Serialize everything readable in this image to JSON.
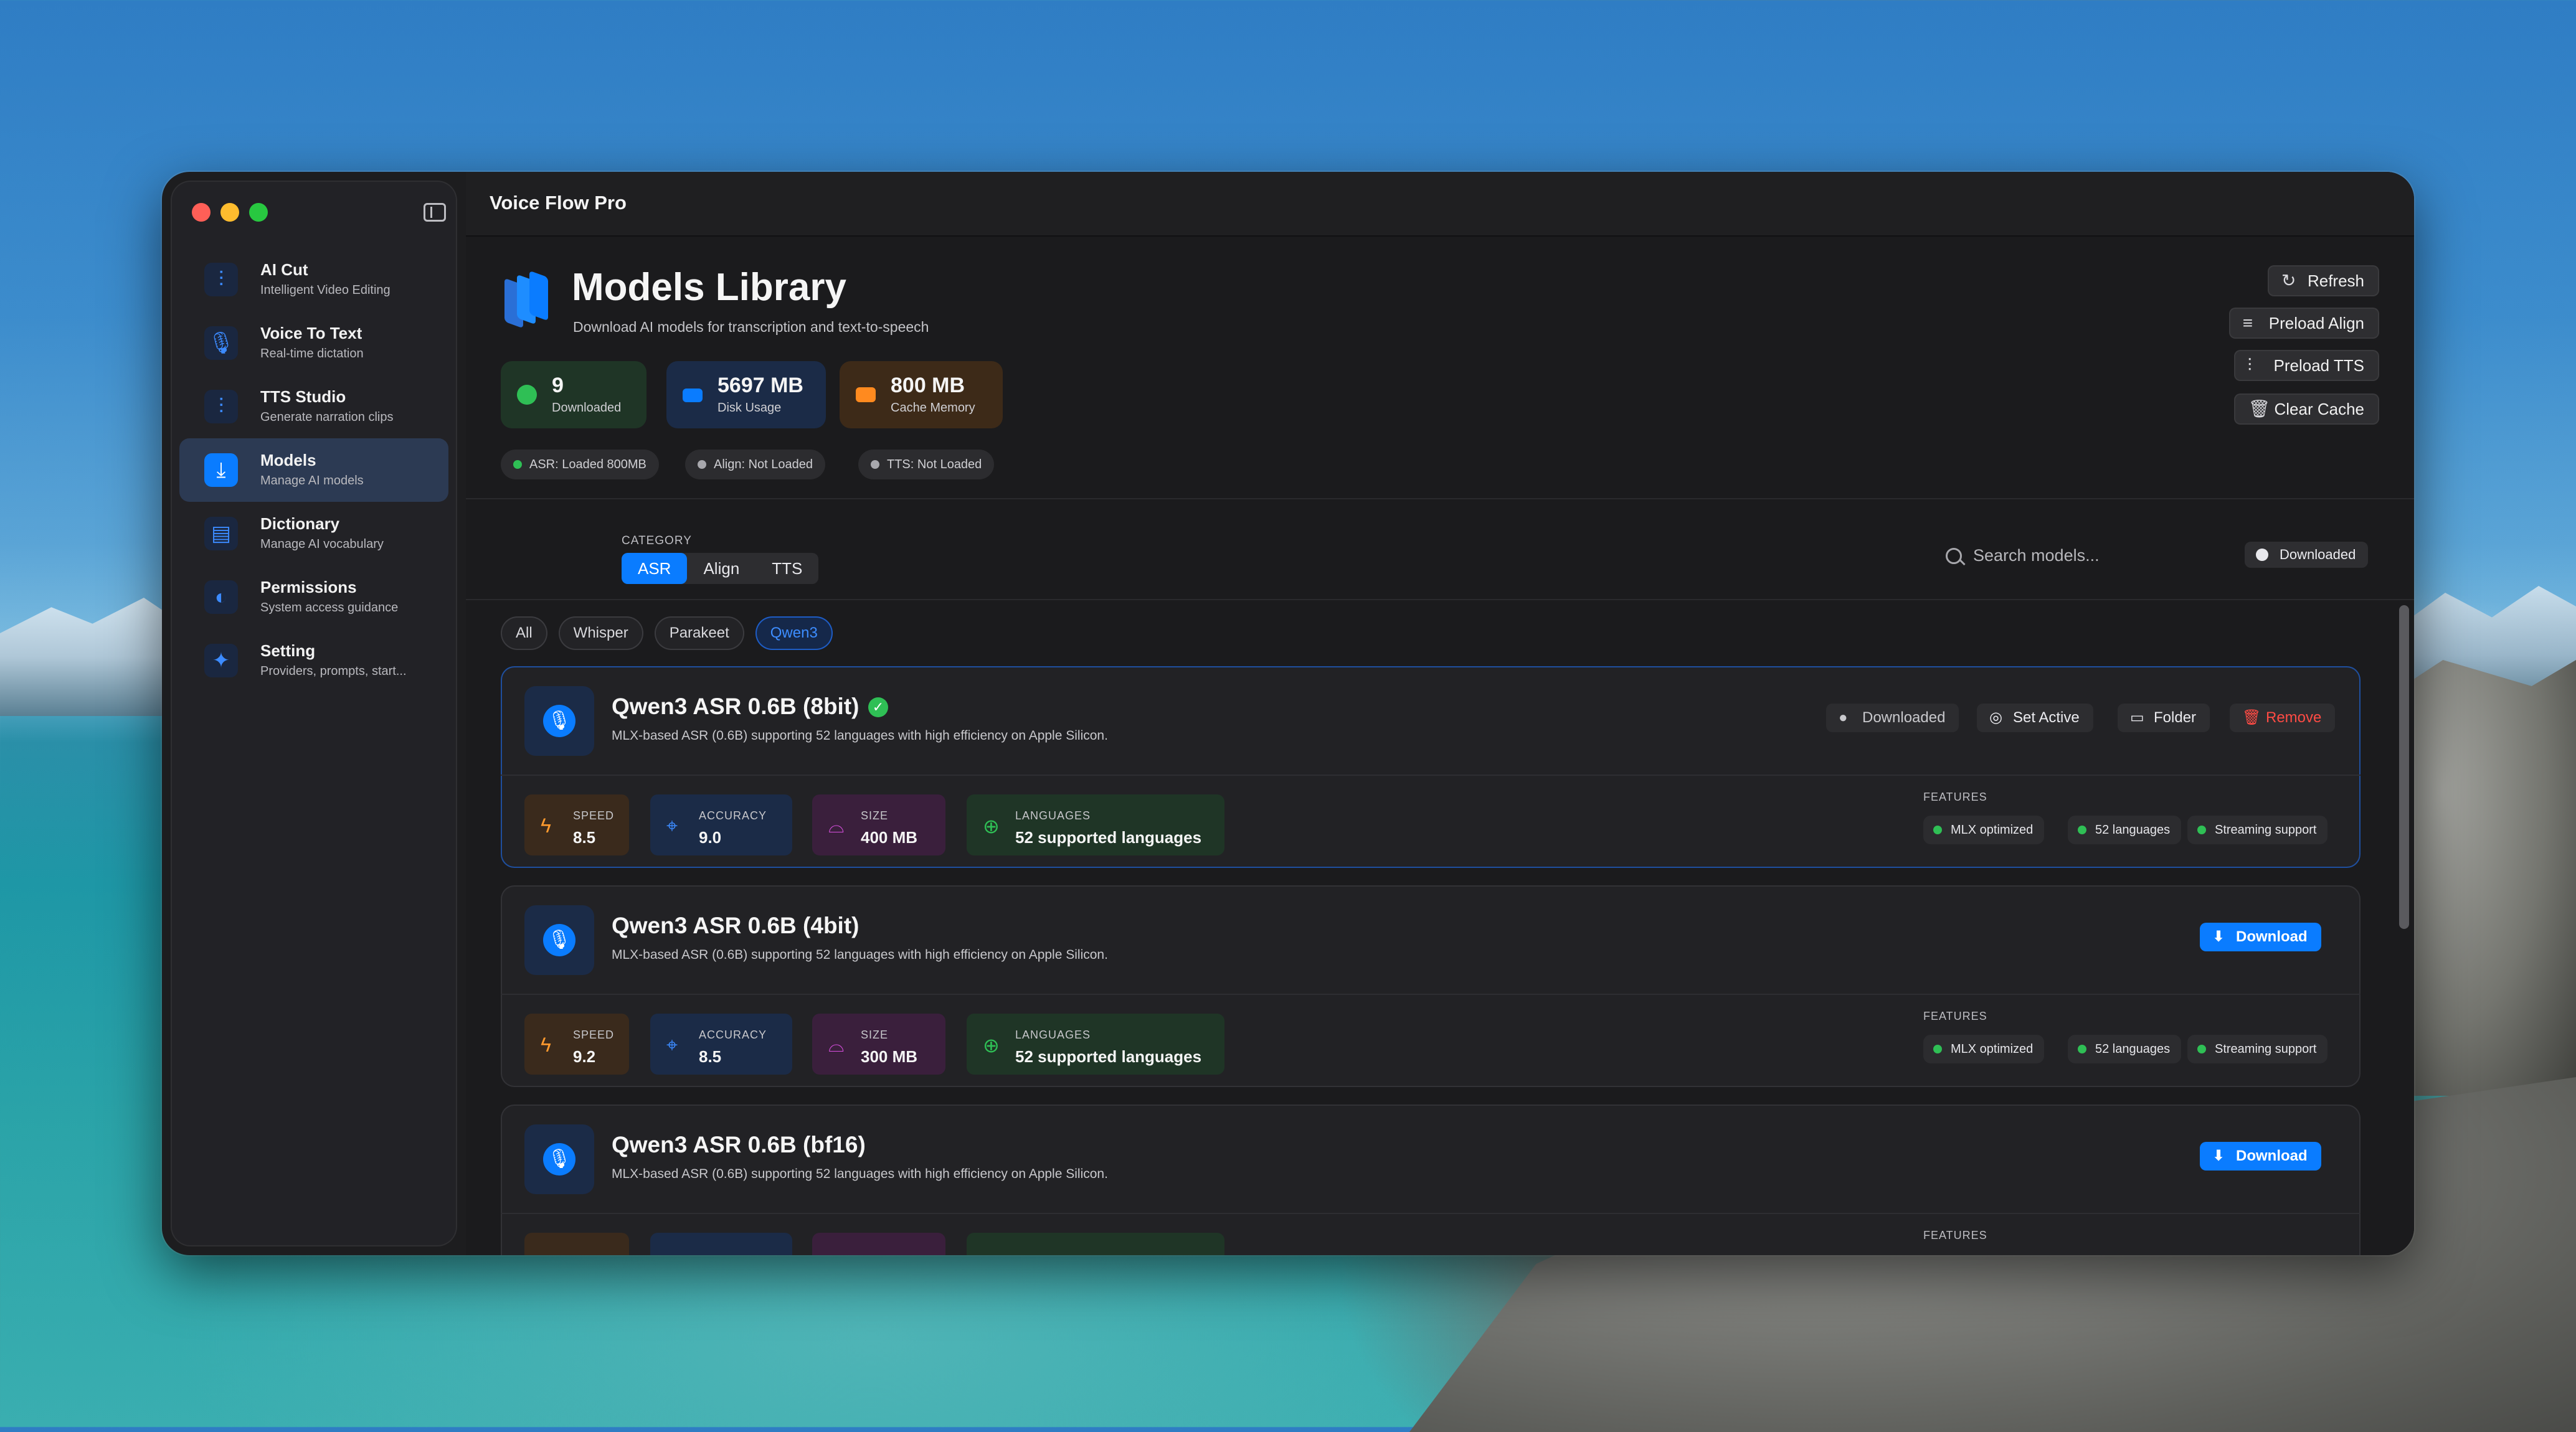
{
  "window": {
    "title": "Voice Flow Pro"
  },
  "sidebar": {
    "items": [
      {
        "title": "AI Cut",
        "subtitle": "Intelligent Video Editing",
        "icon": "waveform-icon"
      },
      {
        "title": "Voice To Text",
        "subtitle": "Real-time dictation",
        "icon": "microphone-icon"
      },
      {
        "title": "TTS Studio",
        "subtitle": "Generate narration clips",
        "icon": "waveform-icon"
      },
      {
        "title": "Models",
        "subtitle": "Manage AI models",
        "icon": "download-box-icon",
        "active": true
      },
      {
        "title": "Dictionary",
        "subtitle": "Manage AI vocabulary",
        "icon": "book-icon"
      },
      {
        "title": "Permissions",
        "subtitle": "System access guidance",
        "icon": "shield-icon"
      },
      {
        "title": "Setting",
        "subtitle": "Providers, prompts, start...",
        "icon": "sparkle-icon"
      }
    ]
  },
  "header": {
    "title": "Models Library",
    "subtitle": "Download AI models for transcription and text-to-speech",
    "stats": [
      {
        "value": "9",
        "label": "Downloaded",
        "color": "#2fbf55"
      },
      {
        "value": "5697 MB",
        "label": "Disk Usage",
        "color": "#0a7cff"
      },
      {
        "value": "800 MB",
        "label": "Cache Memory",
        "color": "#ff8a1f"
      }
    ],
    "status": [
      {
        "text": "ASR: Loaded  800MB",
        "color": "#2fbf55"
      },
      {
        "text": "Align: Not Loaded",
        "color": "#a8a8ad"
      },
      {
        "text": "TTS: Not Loaded",
        "color": "#a8a8ad"
      }
    ],
    "buttons": {
      "refresh": "Refresh",
      "preload_align": "Preload Align",
      "preload_tts": "Preload TTS",
      "clear_cache": "Clear Cache"
    }
  },
  "filters": {
    "category_label": "CATEGORY",
    "categories": [
      "ASR",
      "Align",
      "TTS"
    ],
    "selected_category": "ASR",
    "search_placeholder": "Search models...",
    "downloaded_toggle": "Downloaded",
    "families": [
      "All",
      "Whisper",
      "Parakeet",
      "Qwen3"
    ],
    "selected_family": "Qwen3"
  },
  "models": [
    {
      "name": "Qwen3 ASR 0.6B (8bit)",
      "description": "MLX-based ASR (0.6B) supporting 52 languages with high efficiency on Apple Silicon.",
      "downloaded": true,
      "actions": {
        "state": "Downloaded",
        "set_active": "Set Active",
        "folder": "Folder",
        "remove": "Remove"
      },
      "speed": "8.5",
      "accuracy": "9.0",
      "size": "400 MB",
      "languages": "52 supported languages",
      "features": [
        "MLX optimized",
        "52 languages",
        "Streaming support"
      ]
    },
    {
      "name": "Qwen3 ASR 0.6B (4bit)",
      "description": "MLX-based ASR (0.6B) supporting 52 languages with high efficiency on Apple Silicon.",
      "downloaded": false,
      "actions": {
        "download": "Download"
      },
      "speed": "9.2",
      "accuracy": "8.5",
      "size": "300 MB",
      "languages": "52 supported languages",
      "features": [
        "MLX optimized",
        "52 languages",
        "Streaming support"
      ]
    },
    {
      "name": "Qwen3 ASR 0.6B (bf16)",
      "description": "MLX-based ASR (0.6B) supporting 52 languages with high efficiency on Apple Silicon.",
      "downloaded": false,
      "actions": {
        "download": "Download"
      }
    }
  ],
  "labels": {
    "speed": "SPEED",
    "accuracy": "ACCURACY",
    "size": "SIZE",
    "languages": "LANGUAGES",
    "features": "FEATURES"
  }
}
